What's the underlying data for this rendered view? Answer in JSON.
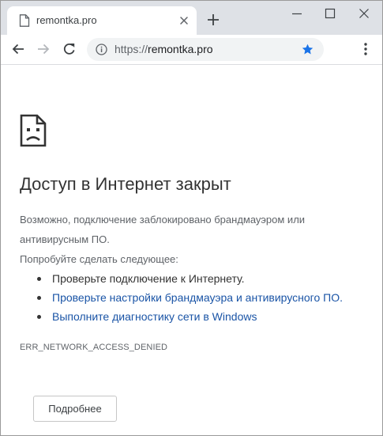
{
  "browser": {
    "tab": {
      "title": "remontka.pro",
      "favicon_icon": "page-icon",
      "close_icon": "close-icon"
    },
    "new_tab_icon": "plus-icon",
    "window_controls": [
      "minimize-icon",
      "maximize-icon",
      "close-icon"
    ],
    "toolbar": {
      "back_icon": "arrow-left-icon",
      "forward_icon": "arrow-right-icon",
      "reload_icon": "reload-icon",
      "url_scheme": "https://",
      "url_host": "remontka.pro",
      "info_icon": "info-icon",
      "bookmark_icon": "star-icon",
      "menu_icon": "three-dots-icon"
    },
    "colors": {
      "tab_strip": "#dee1e6",
      "omnibox": "#f1f3f4",
      "star": "#1a73e8"
    }
  },
  "page": {
    "error_icon": "sad-page-icon",
    "title": "Доступ в Интернет закрыт",
    "description": "Возможно, подключение заблокировано брандмауэром или антивирусным ПО.",
    "suggestions_heading": "Попробуйте сделать следующее:",
    "suggestions": [
      {
        "text": "Проверьте подключение к Интернету.",
        "link": false
      },
      {
        "text": "Проверьте настройки брандмауэра и антивирусного ПО.",
        "link": true
      },
      {
        "text": "Выполните диагностику сети в Windows",
        "link": true
      }
    ],
    "error_code": "ERR_NETWORK_ACCESS_DENIED",
    "details_button": "Подробнее",
    "colors": {
      "title": "#333333",
      "text": "#5f6368",
      "link": "#1a54a6"
    }
  }
}
